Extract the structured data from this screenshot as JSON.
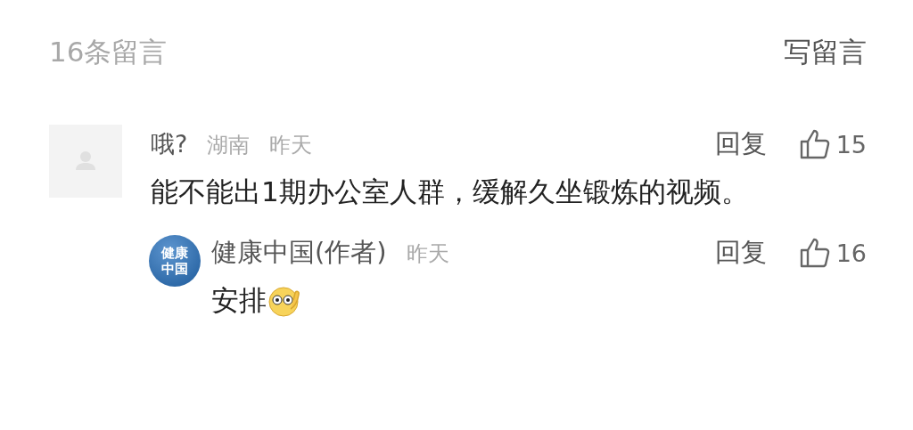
{
  "header": {
    "count": "16条留言",
    "write_button": "写留言"
  },
  "comments": [
    {
      "kind": "user",
      "author": "哦?",
      "location": "湖南",
      "time": "昨天",
      "text": "能不能出1期办公室人群，缓解久坐锻炼的视频。",
      "reply_label": "回复",
      "likes": "15",
      "replies": [
        {
          "kind": "author",
          "avatar_text": "健康中国",
          "author": "健康中国(作者)",
          "time": "昨天",
          "text": "安排",
          "reply_label": "回复",
          "likes": "16"
        }
      ]
    }
  ]
}
